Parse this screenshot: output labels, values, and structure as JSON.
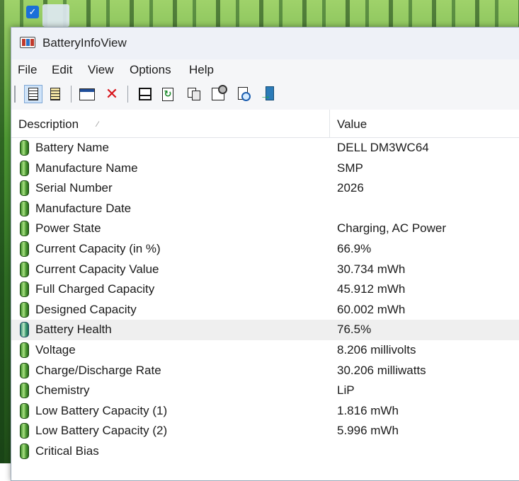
{
  "window": {
    "title": "BatteryInfoView"
  },
  "menu": [
    "File",
    "Edit",
    "View",
    "Options",
    "Help"
  ],
  "toolbar": {
    "icons": [
      "details-icon",
      "clipboard-details-icon",
      "window-icon",
      "delete-icon",
      "save-icon",
      "refresh-icon",
      "copy-icon",
      "properties-icon",
      "find-icon",
      "exit-icon"
    ]
  },
  "columns": {
    "description": "Description",
    "value": "Value"
  },
  "rows": [
    {
      "desc": "Battery Name",
      "value": "DELL DM3WC64"
    },
    {
      "desc": "Manufacture Name",
      "value": "SMP"
    },
    {
      "desc": "Serial Number",
      "value": "2026"
    },
    {
      "desc": "Manufacture Date",
      "value": ""
    },
    {
      "desc": "Power State",
      "value": "Charging, AC Power"
    },
    {
      "desc": "Current Capacity (in %)",
      "value": "66.9%"
    },
    {
      "desc": "Current Capacity Value",
      "value": "30.734 mWh"
    },
    {
      "desc": "Full Charged Capacity",
      "value": "45.912 mWh"
    },
    {
      "desc": "Designed Capacity",
      "value": "60.002 mWh"
    },
    {
      "desc": "Battery Health",
      "value": "76.5%"
    },
    {
      "desc": "Voltage",
      "value": "8.206 millivolts"
    },
    {
      "desc": "Charge/Discharge Rate",
      "value": "30.206 milliwatts"
    },
    {
      "desc": "Chemistry",
      "value": "LiP"
    },
    {
      "desc": "Low Battery Capacity (1)",
      "value": "1.816 mWh"
    },
    {
      "desc": "Low Battery Capacity (2)",
      "value": "5.996 mWh"
    },
    {
      "desc": "Critical Bias",
      "value": ""
    }
  ],
  "selected_row": "Battery Health",
  "colors": {
    "selected_row_bg": "#efefef",
    "battery_icon": "#4d9a33",
    "delete_icon": "#d8141b"
  }
}
